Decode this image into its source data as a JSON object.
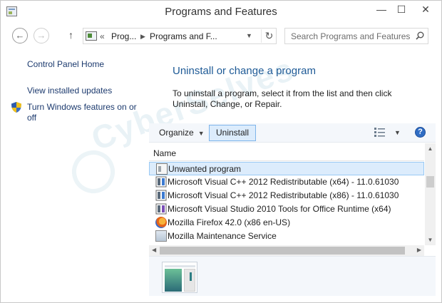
{
  "window": {
    "title": "Programs and Features"
  },
  "title_buttons": {
    "minimize": "—",
    "maximize": "☐",
    "close": "✕"
  },
  "nav": {
    "back": "←",
    "forward": "→",
    "up": "↑",
    "crumb_overflow": "«",
    "crumbs": [
      "Prog...",
      "Programs and F..."
    ],
    "crumb_separator": "▶",
    "dropdown": "▼",
    "refresh": "↻"
  },
  "search": {
    "placeholder": "Search Programs and Features"
  },
  "left_pane": {
    "links": [
      "Control Panel Home",
      "View installed updates",
      "Turn Windows features on or off"
    ]
  },
  "main": {
    "heading": "Uninstall or change a program",
    "description": "To uninstall a program, select it from the list and then click Uninstall, Change, or Repair."
  },
  "toolbar": {
    "organize_label": "Organize",
    "organize_caret": "▼",
    "uninstall_label": "Uninstall",
    "view_caret": "▼",
    "help_label": "?"
  },
  "list": {
    "column_name": "Name",
    "rows": [
      {
        "name": "Unwanted program",
        "icon": "program-box-icon",
        "selected": true
      },
      {
        "name": "Microsoft Visual C++ 2012 Redistributable (x64) - 11.0.61030",
        "icon": "visual-cpp-icon",
        "selected": false
      },
      {
        "name": "Microsoft Visual C++ 2012 Redistributable (x86) - 11.0.61030",
        "icon": "visual-cpp-icon",
        "selected": false
      },
      {
        "name": "Microsoft Visual Studio 2010 Tools for Office Runtime (x64)",
        "icon": "visual-studio-icon",
        "selected": false
      },
      {
        "name": "Mozilla Firefox 42.0 (x86 en-US)",
        "icon": "firefox-icon",
        "selected": false
      },
      {
        "name": "Mozilla Maintenance Service",
        "icon": "mozilla-service-icon",
        "selected": false
      }
    ]
  },
  "scroll": {
    "up": "▲",
    "down": "▼",
    "left": "◀",
    "right": "▶"
  },
  "watermark": {
    "text": "CyberSelves"
  },
  "colors": {
    "link": "#1c3a6e",
    "heading": "#1e5a96",
    "selection_bg": "#dcecfc",
    "selection_border": "#99c9f5"
  }
}
